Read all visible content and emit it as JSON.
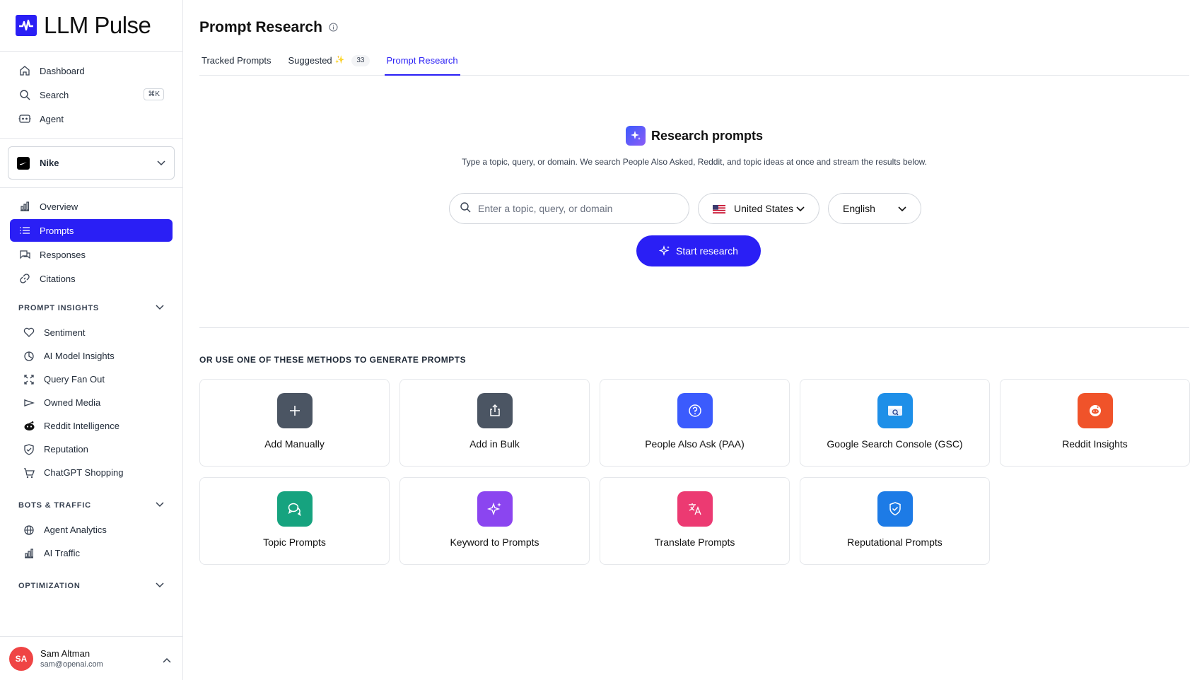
{
  "app": {
    "name": "LLM Pulse"
  },
  "nav_top": [
    {
      "label": "Dashboard",
      "icon": "home-icon"
    },
    {
      "label": "Search",
      "icon": "search-icon",
      "shortcut": "⌘K"
    },
    {
      "label": "Agent",
      "icon": "agent-icon"
    }
  ],
  "brand": {
    "name": "Nike"
  },
  "nav_main": [
    {
      "label": "Overview",
      "icon": "bar-chart-icon"
    },
    {
      "label": "Prompts",
      "icon": "list-icon",
      "active": true
    },
    {
      "label": "Responses",
      "icon": "chat-icon"
    },
    {
      "label": "Citations",
      "icon": "link-icon"
    }
  ],
  "sections": {
    "prompt_insights": {
      "title": "PROMPT INSIGHTS",
      "items": [
        {
          "label": "Sentiment",
          "icon": "heart-icon"
        },
        {
          "label": "AI Model Insights",
          "icon": "pie-icon"
        },
        {
          "label": "Query Fan Out",
          "icon": "expand-icon"
        },
        {
          "label": "Owned Media",
          "icon": "megaphone-icon"
        },
        {
          "label": "Reddit Intelligence",
          "icon": "reddit-icon"
        },
        {
          "label": "Reputation",
          "icon": "shield-icon"
        },
        {
          "label": "ChatGPT Shopping",
          "icon": "cart-icon"
        }
      ]
    },
    "bots_traffic": {
      "title": "BOTS & TRAFFIC",
      "items": [
        {
          "label": "Agent Analytics",
          "icon": "globe-icon"
        },
        {
          "label": "AI Traffic",
          "icon": "bar-chart-icon"
        }
      ]
    },
    "optimization": {
      "title": "OPTIMIZATION"
    }
  },
  "user": {
    "initials": "SA",
    "name": "Sam Altman",
    "email": "sam@openai.com"
  },
  "page": {
    "title": "Prompt Research",
    "tabs": [
      {
        "label": "Tracked Prompts"
      },
      {
        "label": "Suggested",
        "badge": "33"
      },
      {
        "label": "Prompt Research",
        "active": true
      }
    ]
  },
  "research": {
    "title": "Research prompts",
    "description": "Type a topic, query, or domain. We search People Also Asked, Reddit, and topic ideas at once and stream the results below.",
    "search_placeholder": "Enter a topic, query, or domain",
    "country": "United States",
    "language": "English",
    "start_label": "Start research"
  },
  "methods": {
    "heading": "OR USE ONE OF THESE METHODS TO GENERATE PROMPTS",
    "cards": [
      {
        "label": "Add Manually",
        "icon": "plus-icon",
        "color": "#4b5563"
      },
      {
        "label": "Add in Bulk",
        "icon": "upload-icon",
        "color": "#4b5563"
      },
      {
        "label": "People Also Ask (PAA)",
        "icon": "question-icon",
        "color": "#3b5bfd"
      },
      {
        "label": "Google Search Console (GSC)",
        "icon": "gsc-icon",
        "color": "#1e8fe8"
      },
      {
        "label": "Reddit Insights",
        "icon": "reddit-icon",
        "color": "#f0532a"
      },
      {
        "label": "Topic Prompts",
        "icon": "chat-bubbles-icon",
        "color": "#16a37f"
      },
      {
        "label": "Keyword to Prompts",
        "icon": "sparkle-icon",
        "color": "#8b45f0"
      },
      {
        "label": "Translate Prompts",
        "icon": "translate-icon",
        "color": "#ec3a72"
      },
      {
        "label": "Reputational Prompts",
        "icon": "shield-check-icon",
        "color": "#1d7be6"
      }
    ]
  },
  "colors": {
    "accent": "#2a1ff5",
    "avatar": "#ef4444"
  }
}
